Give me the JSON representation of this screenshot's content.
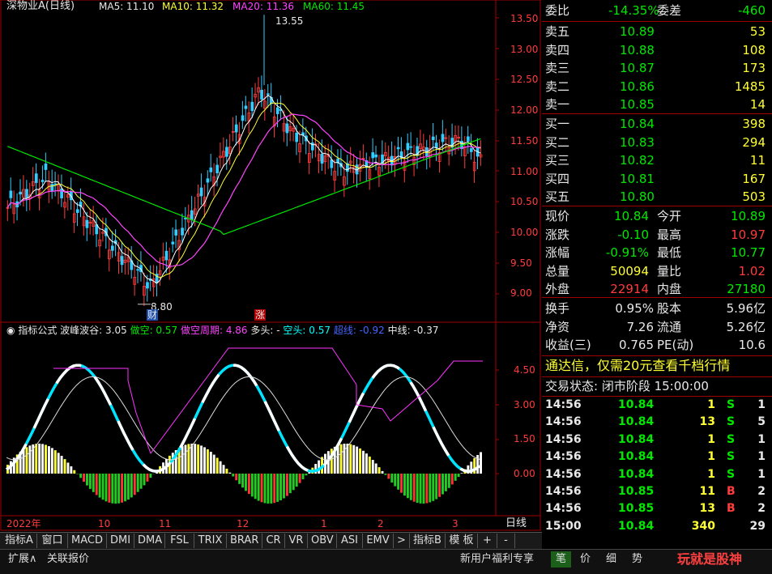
{
  "main_chart": {
    "legend": {
      "title": "深物业A(日线)",
      "ma5": "MA5: 11.10",
      "ma10": "MA10: 11.32",
      "ma20": "MA20: 11.36",
      "ma60": "MA60: 11.45"
    },
    "y_labels": [
      "13.50",
      "13.00",
      "12.50",
      "12.00",
      "11.50",
      "11.00",
      "10.50",
      "10.00",
      "9.50",
      "9.00"
    ],
    "high_annotation": "13.55",
    "low_annotation": "8.80",
    "marker_cai": "财",
    "marker_zhang": "涨"
  },
  "indicator": {
    "name": "指标公式",
    "wave": "波峰波谷: 3.05",
    "zuokong": "做空: 0.57",
    "zuokong_period": "做空周期: 4.86",
    "duotou": "多头: -",
    "kongtou": "空头: 0.57",
    "chaoxian": "超线: -0.92",
    "zhongxian": "中线: -0.37",
    "y_labels": [
      "4.50",
      "3.00",
      "1.50",
      "0.00"
    ]
  },
  "date_axis": [
    "2022年",
    "10",
    "11",
    "12",
    "1",
    "2",
    "3"
  ],
  "period_label": "日线",
  "order_book": {
    "weibi_label": "委比",
    "weibi_value": "-14.35%",
    "weicha_label": "委差",
    "weicha_value": "-460",
    "asks": [
      {
        "label": "卖五",
        "price": "10.89",
        "vol": "53"
      },
      {
        "label": "卖四",
        "price": "10.88",
        "vol": "108"
      },
      {
        "label": "卖三",
        "price": "10.87",
        "vol": "173"
      },
      {
        "label": "卖二",
        "price": "10.86",
        "vol": "1485"
      },
      {
        "label": "卖一",
        "price": "10.85",
        "vol": "14"
      }
    ],
    "bids": [
      {
        "label": "买一",
        "price": "10.84",
        "vol": "398"
      },
      {
        "label": "买二",
        "price": "10.83",
        "vol": "294"
      },
      {
        "label": "买三",
        "price": "10.82",
        "vol": "11"
      },
      {
        "label": "买四",
        "price": "10.81",
        "vol": "167"
      },
      {
        "label": "买五",
        "price": "10.80",
        "vol": "503"
      }
    ]
  },
  "quote": {
    "xianjia_l": "现价",
    "xianjia": "10.84",
    "jinkai_l": "今开",
    "jinkai": "10.89",
    "zhangdie_l": "涨跌",
    "zhangdie": "-0.10",
    "zuigao_l": "最高",
    "zuigao": "10.97",
    "zhangfu_l": "涨幅",
    "zhangfu": "-0.91%",
    "zuidi_l": "最低",
    "zuidi": "10.77",
    "zongliang_l": "总量",
    "zongliang": "50094",
    "liangbi_l": "量比",
    "liangbi": "1.02",
    "waipan_l": "外盘",
    "waipan": "22914",
    "neipan_l": "内盘",
    "neipan": "27180",
    "huanshou_l": "换手",
    "huanshou": "0.95%",
    "guben_l": "股本",
    "guben": "5.96亿",
    "jingzi_l": "净资",
    "jingzi": "7.26",
    "liutong_l": "流通",
    "liutong": "5.26亿",
    "shouyi_l": "收益(三)",
    "shouyi": "0.765",
    "pe_l": "PE(动)",
    "pe": "10.6"
  },
  "promo": "通达信，仅需20元查看千档行情",
  "trade_status": "交易状态: 闭市阶段 15:00:00",
  "ticks": [
    {
      "time": "14:56",
      "price": "10.84",
      "vol": "1",
      "side": "S",
      "n": "1"
    },
    {
      "time": "14:56",
      "price": "10.84",
      "vol": "13",
      "side": "S",
      "n": "5"
    },
    {
      "time": "14:56",
      "price": "10.84",
      "vol": "1",
      "side": "S",
      "n": "1"
    },
    {
      "time": "14:56",
      "price": "10.84",
      "vol": "1",
      "side": "S",
      "n": "1"
    },
    {
      "time": "14:56",
      "price": "10.84",
      "vol": "1",
      "side": "S",
      "n": "1"
    },
    {
      "time": "14:56",
      "price": "10.85",
      "vol": "11",
      "side": "B",
      "n": "2"
    },
    {
      "time": "14:56",
      "price": "10.85",
      "vol": "13",
      "side": "B",
      "n": "2"
    },
    {
      "time": "15:00",
      "price": "10.84",
      "vol": "340",
      "side": "",
      "n": "29"
    }
  ],
  "indicator_tabs": [
    "指标A",
    "窗口",
    "MACD",
    "DMI",
    "DMA",
    "FSL",
    "TRIX",
    "BRAR",
    "CR",
    "VR",
    "OBV",
    "ASI",
    "EMV",
    ">",
    "指标B",
    "模 板",
    "+",
    "-"
  ],
  "bottom": {
    "expand": "扩展∧",
    "related": "关联报价",
    "welfare": "新用户福利专享",
    "tabs": [
      "笔",
      "价",
      "细",
      "势"
    ]
  },
  "watermark": "玩就是股神",
  "colors": {
    "up": "#ff3c3c",
    "down": "#00e800",
    "ma5": "#ffffff",
    "ma10": "#ffff33",
    "ma20": "#ff44ff",
    "ma60": "#00e800",
    "cyan": "#00ffff",
    "frame": "#a00000"
  }
}
